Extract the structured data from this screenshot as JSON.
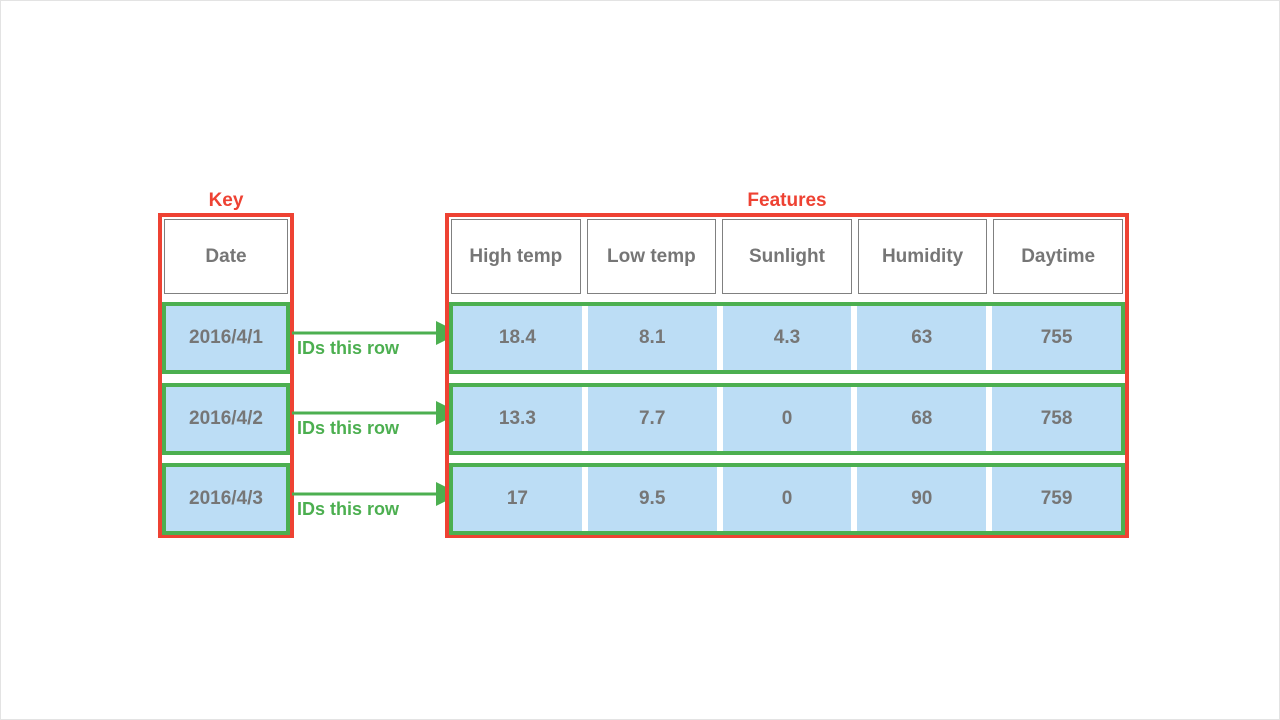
{
  "sections": {
    "key": {
      "title": "Key",
      "header": [
        "Date"
      ],
      "rows": [
        [
          "2016/4/1"
        ],
        [
          "2016/4/2"
        ],
        [
          "2016/4/3"
        ]
      ]
    },
    "features": {
      "title": "Features",
      "header": [
        "High temp",
        "Low temp",
        "Sunlight",
        "Humidity",
        "Daytime"
      ],
      "rows": [
        [
          "18.4",
          "8.1",
          "4.3",
          "63",
          "755"
        ],
        [
          "13.3",
          "7.7",
          "0",
          "68",
          "758"
        ],
        [
          "17",
          "9.5",
          "0",
          "90",
          "759"
        ]
      ]
    }
  },
  "arrows": [
    {
      "label": "IDs this row"
    },
    {
      "label": "IDs this row"
    },
    {
      "label": "IDs this row"
    }
  ],
  "colors": {
    "accent_red": "#ee4233",
    "accent_green": "#4caf50",
    "cell_fill_blue": "#bcddf5",
    "text_gray": "#767676",
    "header_border_gray": "#808080"
  }
}
